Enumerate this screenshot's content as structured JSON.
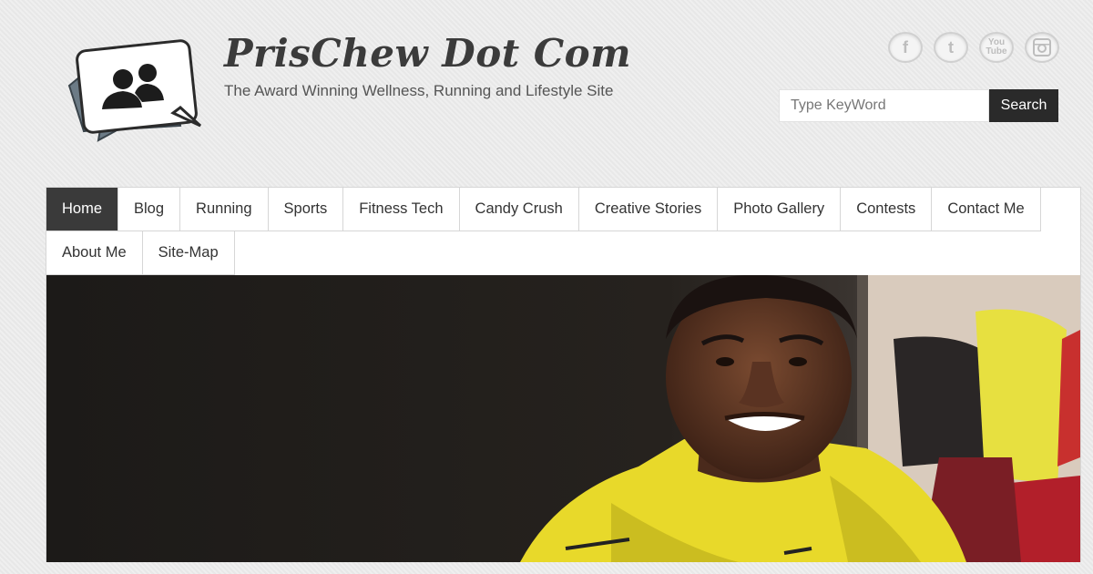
{
  "header": {
    "title": "PrisChew Dot Com",
    "tagline": "The Award Winning Wellness, Running and Lifestyle Site"
  },
  "social": [
    {
      "name": "facebook",
      "glyph": "f"
    },
    {
      "name": "twitter",
      "glyph": "t"
    },
    {
      "name": "youtube",
      "glyph": "You Tube"
    },
    {
      "name": "instagram",
      "glyph": ""
    }
  ],
  "search": {
    "placeholder": "Type KeyWord",
    "button_label": "Search"
  },
  "nav": {
    "items": [
      {
        "label": "Home",
        "active": true
      },
      {
        "label": "Blog"
      },
      {
        "label": "Running"
      },
      {
        "label": "Sports"
      },
      {
        "label": "Fitness Tech"
      },
      {
        "label": "Candy Crush"
      },
      {
        "label": "Creative Stories"
      },
      {
        "label": "Photo Gallery"
      },
      {
        "label": "Contests"
      },
      {
        "label": "Contact Me"
      },
      {
        "label": "About Me"
      },
      {
        "label": "Site-Map"
      }
    ]
  },
  "colors": {
    "nav_active_bg": "#3a3a3a",
    "search_button_bg": "#2a2a2a",
    "shirt_yellow": "#e8d92a"
  }
}
